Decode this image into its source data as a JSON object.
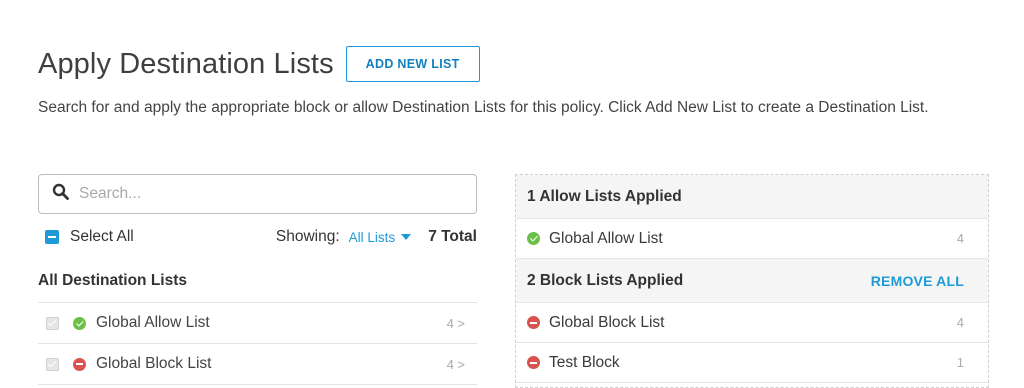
{
  "header": {
    "title": "Apply Destination Lists",
    "add_button": "ADD NEW LIST",
    "description": "Search for and apply the appropriate block or allow Destination Lists for this policy. Click Add New List to create a Destination List."
  },
  "search": {
    "placeholder": "Search...",
    "icon": "search-icon"
  },
  "controls": {
    "select_all": "Select All",
    "showing_label": "Showing:",
    "showing_value": "All Lists",
    "total": "7 Total"
  },
  "all_lists": {
    "label": "All Destination Lists",
    "items": [
      {
        "name": "Global Allow List",
        "type": "allow",
        "count": "4 >"
      },
      {
        "name": "Global Block List",
        "type": "block",
        "count": "4 >"
      }
    ]
  },
  "applied": {
    "allow_header": "1 Allow Lists Applied",
    "allow_items": [
      {
        "name": "Global Allow List",
        "type": "allow",
        "count": "4"
      }
    ],
    "block_header": "2 Block Lists Applied",
    "remove_all": "REMOVE ALL",
    "block_items": [
      {
        "name": "Global Block List",
        "type": "block",
        "count": "4"
      },
      {
        "name": "Test Block",
        "type": "block",
        "count": "1"
      }
    ]
  },
  "colors": {
    "accent": "#1e9ad6",
    "allow": "#6cc04a",
    "block": "#d9534f"
  }
}
